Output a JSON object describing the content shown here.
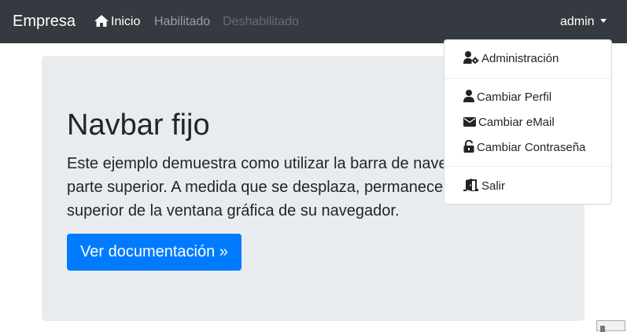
{
  "navbar": {
    "brand": "Empresa",
    "links": {
      "home": "Inicio",
      "enabled": "Habilitado",
      "disabled": "Deshabilitado"
    },
    "user": "admin"
  },
  "jumbotron": {
    "title": "Navbar fijo",
    "lead": "Este ejemplo demuestra como utilizar la barra de navegación en la parte superior. A medida que se desplaza, permanecerá fijo en la parte superior de la ventana gráfica de su navegador.",
    "button": "Ver documentación »"
  },
  "user_menu": {
    "items": [
      {
        "label": "Administración",
        "icon": "user-cog-icon"
      },
      {
        "label": "Cambiar Perfil",
        "icon": "user-icon"
      },
      {
        "label": "Cambiar eMail",
        "icon": "envelope-icon"
      },
      {
        "label": "Cambiar Contraseña",
        "icon": "unlock-icon"
      },
      {
        "label": "Salir",
        "icon": "door-exit-icon"
      }
    ]
  },
  "colors": {
    "navbar": "#343a40",
    "primary": "#007bff",
    "jumbotron": "#e9ecef"
  }
}
